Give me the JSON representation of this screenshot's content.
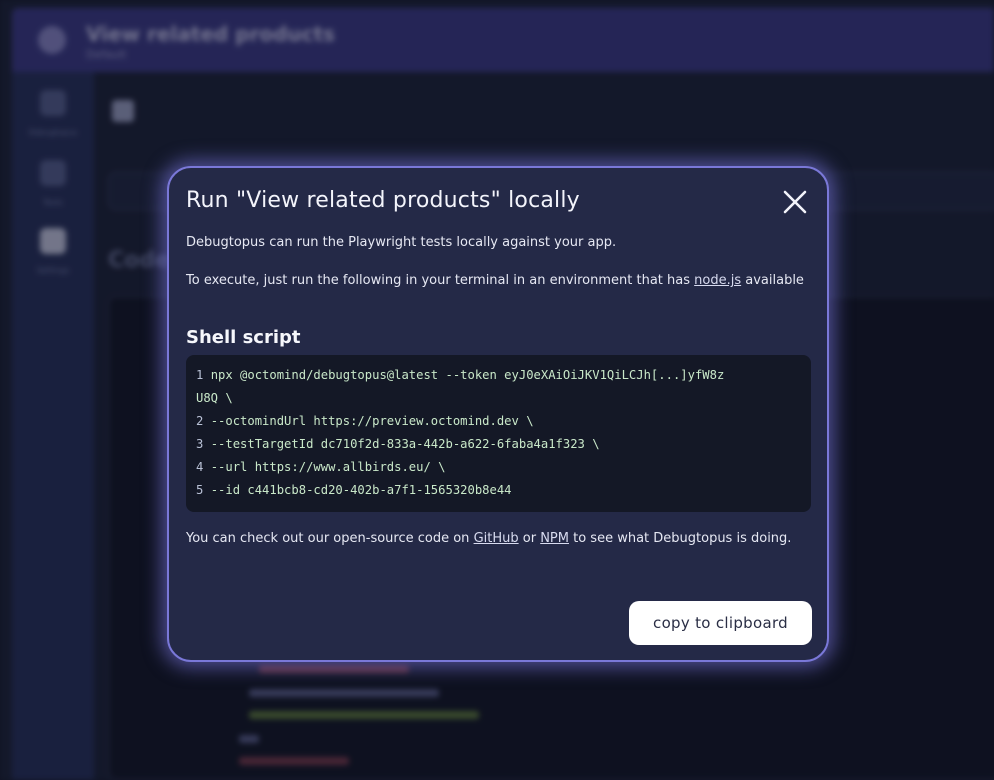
{
  "background": {
    "page_title": "View related products",
    "page_subtitle": "Default",
    "sidebar_items": [
      {
        "icon": "octopus-icon",
        "label": "Debugtopus"
      },
      {
        "icon": "test-icon",
        "label": "Tests"
      },
      {
        "icon": "settings-icon",
        "label": "Settings"
      }
    ],
    "section_heading": "Code"
  },
  "modal": {
    "title": "Run \"View related products\" locally",
    "intro": "Debugtopus can run the Playwright tests locally against your app.",
    "execute_text_before": "To execute, just run the following in your terminal in an environment that has ",
    "execute_link": "node.js",
    "execute_text_after": " available",
    "shell_heading": "Shell script",
    "code_lines": [
      {
        "num": "1",
        "text": "npx @octomind/debugtopus@latest --token eyJ0eXAiOiJKV1QiLCJh[...]yfW8z"
      },
      {
        "num": "",
        "text": "U8Q \\"
      },
      {
        "num": "2",
        "text": "--octomindUrl https://preview.octomind.dev \\"
      },
      {
        "num": "3",
        "text": "--testTargetId dc710f2d-833a-442b-a622-6faba4a1f323 \\"
      },
      {
        "num": "4",
        "text": "--url https://www.allbirds.eu/ \\"
      },
      {
        "num": "5",
        "text": "--id c441bcb8-cd20-402b-a7f1-1565320b8e44"
      }
    ],
    "footer_text_1": "You can check out our open-source code on ",
    "github_link": "GitHub",
    "footer_text_2": " or ",
    "npm_link": "NPM",
    "footer_text_3": " to see what Debugtopus is doing.",
    "copy_button": "copy to clipboard",
    "close_icon": "close-icon"
  },
  "colors": {
    "modal_bg": "#242947",
    "modal_border": "#7a78d8",
    "code_bg": "#141826",
    "code_text": "#c9e8c9",
    "topbar": "#3b3a86"
  }
}
